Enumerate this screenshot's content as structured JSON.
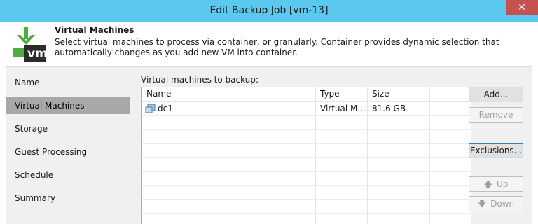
{
  "window": {
    "title": "Edit Backup Job [vm-13]",
    "close_glyph": "✕"
  },
  "header": {
    "icon": "vm-download-icon",
    "icon_text": "vm",
    "title": "Virtual Machines",
    "description": "Select virtual machines to process via container, or granularly. Container provides dynamic selection that automatically changes as you add new VM into container."
  },
  "nav": {
    "items": [
      {
        "label": "Name"
      },
      {
        "label": "Virtual Machines",
        "active": true
      },
      {
        "label": "Storage"
      },
      {
        "label": "Guest Processing"
      },
      {
        "label": "Schedule"
      },
      {
        "label": "Summary"
      }
    ]
  },
  "main": {
    "list_label": "Virtual machines to backup:",
    "columns": [
      "Name",
      "Type",
      "Size"
    ],
    "rows": [
      {
        "icon": "vm-folder-icon",
        "name": "dc1",
        "type": "Virtual M...",
        "size": "81.6 GB"
      }
    ]
  },
  "buttons": {
    "add": "Add...",
    "remove": "Remove",
    "exclusions": "Exclusions...",
    "up": "Up",
    "down": "Down",
    "up_glyph": "🡅",
    "down_glyph": "🡇"
  },
  "colors": {
    "titlebar": "#5bc8ef",
    "close": "#c75050",
    "selected_nav": "#a8a8a8",
    "panel": "#f0f0f0",
    "icon_green": "#4cae3e",
    "icon_dark": "#2b2b2b"
  }
}
